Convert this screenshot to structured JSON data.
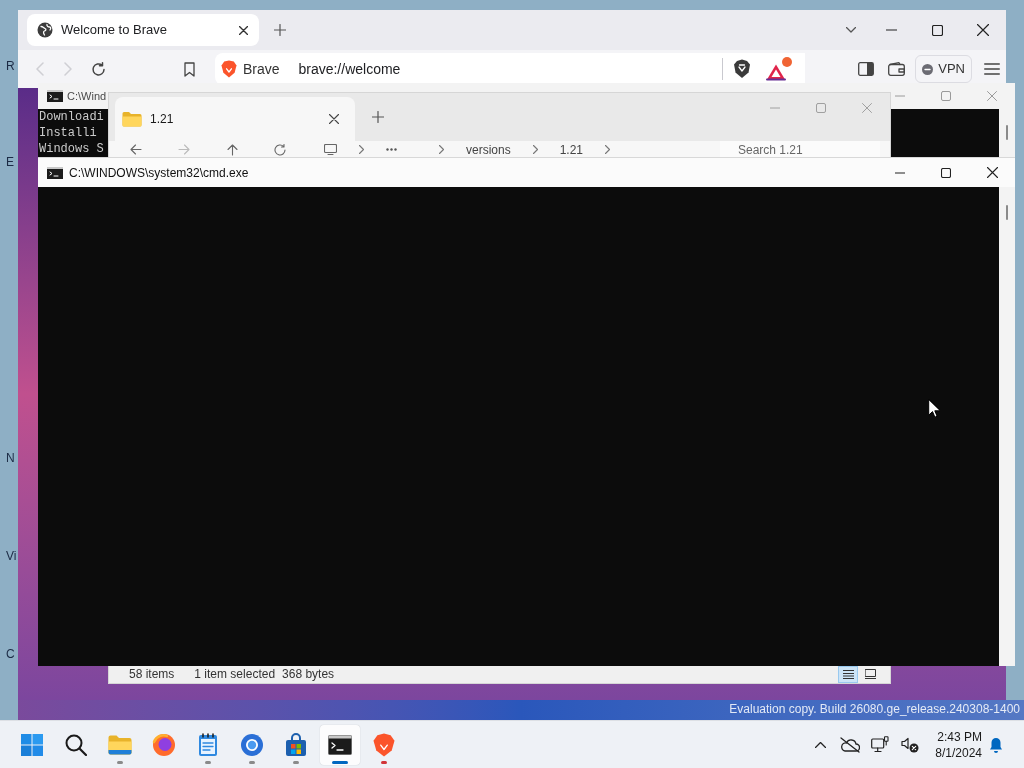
{
  "desktop": {
    "icon_labels": [
      "R",
      "E",
      "N",
      "Vi",
      "C"
    ],
    "evaluation_notice": "Evaluation copy. Build 26080.ge_release.240308-1400"
  },
  "browser": {
    "tabs": [
      {
        "title": "Welcome to Brave",
        "selected": true
      }
    ],
    "back": {
      "disabled": true
    },
    "forward": {
      "disabled": true
    },
    "site_label": "Brave",
    "url": "brave://welcome",
    "vpn_label": "VPN"
  },
  "console_back": {
    "title": "C:\\Wind",
    "lines": [
      "Downloadi",
      "Installi",
      "Windows S"
    ]
  },
  "explorer": {
    "tabs": [
      {
        "title": "1.21",
        "selected": true
      }
    ],
    "breadcrumb": [
      "versions",
      "1.21"
    ],
    "search_placeholder": "Search 1.21",
    "status": [
      "58 items",
      "1 item selected",
      "368 bytes"
    ],
    "views": [
      {
        "kind": "details",
        "selected": true
      },
      {
        "kind": "tiles",
        "selected": false
      }
    ]
  },
  "console_front": {
    "title": "C:\\WINDOWS\\system32\\cmd.exe"
  },
  "taskbar": {
    "apps": [
      {
        "kind": "start",
        "running": false,
        "active": false,
        "attention": false
      },
      {
        "kind": "search",
        "running": false,
        "active": false,
        "attention": false
      },
      {
        "kind": "folder",
        "running": true,
        "active": false,
        "attention": false
      },
      {
        "kind": "fox-browser",
        "running": false,
        "active": false,
        "attention": false
      },
      {
        "kind": "notepad",
        "running": true,
        "active": false,
        "attention": false
      },
      {
        "kind": "blue-browser",
        "running": true,
        "active": false,
        "attention": false
      },
      {
        "kind": "store",
        "running": true,
        "active": false,
        "attention": false
      },
      {
        "kind": "console",
        "running": true,
        "active": true,
        "attention": false
      },
      {
        "kind": "lion-browser",
        "running": true,
        "active": false,
        "attention": true
      }
    ],
    "clock": {
      "time": "2:43 PM",
      "date": "8/1/2024"
    }
  }
}
